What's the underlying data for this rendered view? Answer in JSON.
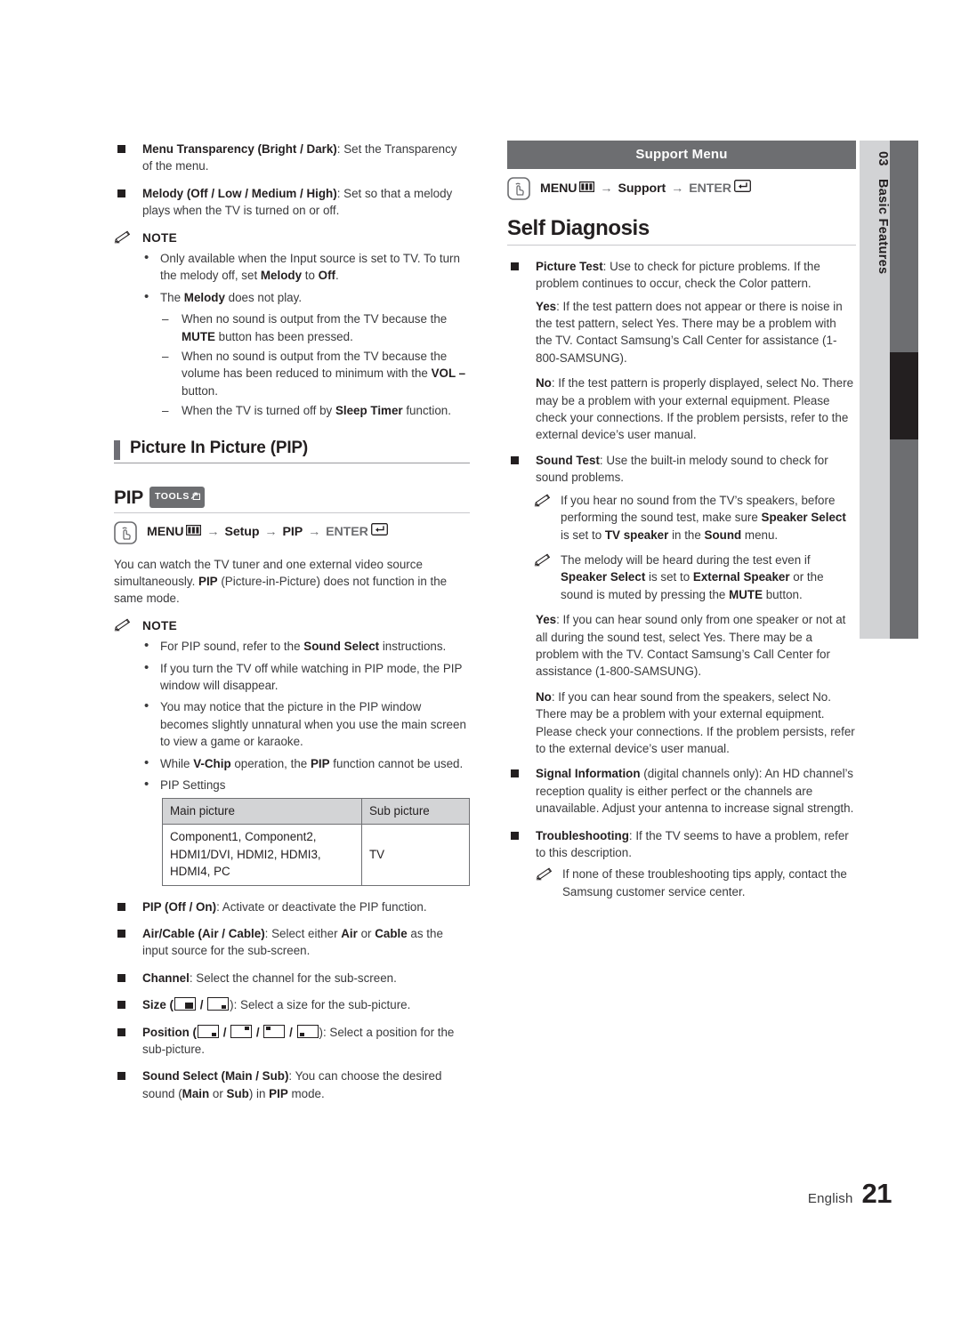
{
  "page": {
    "language": "English",
    "number": "21",
    "chapter_number": "03",
    "chapter_title": "Basic Features"
  },
  "left": {
    "menu_transparency": {
      "label": "Menu Transparency (Bright / Dark)",
      "text": ": Set the Transparency of the menu."
    },
    "melody": {
      "label": "Melody (Off / Low / Medium / High)",
      "text": ": Set so that a melody plays when the TV is turned on or off."
    },
    "note_label": "NOTE",
    "note_items": [
      {
        "pre": "Only available when the Input source is set to TV. To turn the melody off, set ",
        "b1": "Melody",
        "mid": " to ",
        "b2": "Off",
        "post": "."
      },
      {
        "pre": "The ",
        "b1": "Melody",
        "mid": " does not play.",
        "b2": "",
        "post": ""
      }
    ],
    "melody_dashes": [
      {
        "pre": "When no sound is output from the TV because the ",
        "b": "MUTE",
        "post": " button has been pressed."
      },
      {
        "pre": "When no sound is output from the TV because the volume has been reduced to minimum with the ",
        "b": "VOL –",
        "post": " button."
      },
      {
        "pre": "When the TV is turned off by ",
        "b": "Sleep Timer",
        "post": " function."
      }
    ],
    "pip_section_title": "Picture In Picture (PIP)",
    "pip_sub_title": "PIP",
    "tools_badge": "TOOLS",
    "pip_path": {
      "menu": "MENU",
      "arrow": "→",
      "step1": "Setup",
      "step2": "PIP",
      "enter": "ENTER"
    },
    "pip_intro": {
      "pre": "You can watch the TV tuner and one external video source simultaneously. ",
      "b": "PIP",
      "post": " (Picture-in-Picture) does not function in the same mode."
    },
    "pip_note_label": "NOTE",
    "pip_notes": [
      {
        "pre": "For PIP sound, refer to the ",
        "b": "Sound Select",
        "post": " instructions."
      },
      {
        "pre": "If you turn the TV off while watching in PIP mode, the PIP window will disappear.",
        "b": "",
        "post": ""
      },
      {
        "pre": "You may notice that the picture in the PIP window becomes slightly unnatural when you use the main screen to view a game or karaoke.",
        "b": "",
        "post": ""
      },
      {
        "pre": "While ",
        "b": "V-Chip",
        "mid": " operation, the ",
        "b2": "PIP",
        "post": " function cannot be used."
      },
      {
        "pre": "PIP Settings",
        "b": "",
        "post": ""
      }
    ],
    "table": {
      "headers": [
        "Main picture",
        "Sub picture"
      ],
      "rows": [
        {
          "main": "Component1, Component2, HDMI1/DVI, HDMI2, HDMI3, HDMI4, PC",
          "sub": "TV"
        }
      ]
    },
    "pip_options": [
      {
        "label": "PIP (Off / On)",
        "text": ": Activate or deactivate the PIP function."
      },
      {
        "label": "Air/Cable (Air / Cable)",
        "pre": ": Select either ",
        "b1": "Air",
        "mid": " or ",
        "b2": "Cable",
        "post": " as the input source for the sub-screen."
      },
      {
        "label": "Channel",
        "text": ": Select the channel for the sub-screen."
      },
      {
        "label": "Size",
        "icons": [
          "pip-size-large-icon",
          "pip-size-small-icon"
        ],
        "text": "): Select a size for the sub-picture."
      },
      {
        "label": "Position",
        "icons": [
          "pip-position-bottom-right-icon",
          "pip-position-top-right-icon",
          "pip-position-top-left-icon",
          "pip-position-bottom-left-icon"
        ],
        "text": "): Select a position for the sub-picture."
      },
      {
        "label": "Sound Select (Main / Sub)",
        "pre": ": You can choose the desired sound (",
        "b1": "Main",
        "mid": " or ",
        "b2": "Sub",
        "mid2": ") in ",
        "b3": "PIP",
        "post": " mode."
      }
    ]
  },
  "right": {
    "support_bar": "Support Menu",
    "support_path": {
      "menu": "MENU",
      "arrow": "→",
      "step1": "Support",
      "enter": "ENTER"
    },
    "self_diagnosis_title": "Self Diagnosis",
    "picture_test": {
      "label": "Picture Test",
      "text": ": Use to check for picture problems. If the problem continues to occur, check the Color pattern.",
      "yes_label": "Yes",
      "yes_text": ": If the test pattern does not appear or there is noise in the test pattern, select Yes. There may be a problem with the TV. Contact Samsung’s Call Center for assistance (1-800-SAMSUNG).",
      "no_label": "No",
      "no_text": ": If the test pattern is properly displayed, select No. There may be a problem with your external equipment. Please check your connections. If the problem persists, refer to the external device’s user manual."
    },
    "sound_test": {
      "label": "Sound Test",
      "text": ": Use the built-in melody sound to check for sound problems.",
      "notes": [
        {
          "pre": "If you hear no sound from the TV’s speakers, before performing the sound test, make sure ",
          "b1": "Speaker Select",
          "mid": " is set to ",
          "b2": "TV speaker",
          "mid2": " in the ",
          "b3": "Sound",
          "post": " menu."
        },
        {
          "pre": "The melody will be heard during the test even if ",
          "b1": "Speaker Select",
          "mid": " is set to ",
          "b2": "External Speaker",
          "mid2": " or the sound is muted by pressing the ",
          "b3": "MUTE",
          "post": " button."
        }
      ],
      "yes_label": "Yes",
      "yes_text": ": If you can hear sound only from one speaker or not at all during the sound test, select Yes. There may be a problem with the TV. Contact Samsung’s Call Center for assistance (1-800-SAMSUNG).",
      "no_label": "No",
      "no_text": ": If you can hear sound from the speakers, select No. There may be a problem with your external equipment. Please check your connections. If the problem persists, refer to the external device’s user manual."
    },
    "signal_information": {
      "label": "Signal Information",
      "text": " (digital channels only): An HD channel’s reception quality is either perfect or the channels are unavailable. Adjust your antenna to increase signal strength."
    },
    "troubleshooting": {
      "label": "Troubleshooting",
      "text": ": If the TV seems to have a problem, refer to this description.",
      "note": "If none of these troubleshooting tips apply, contact the Samsung customer service center."
    }
  }
}
